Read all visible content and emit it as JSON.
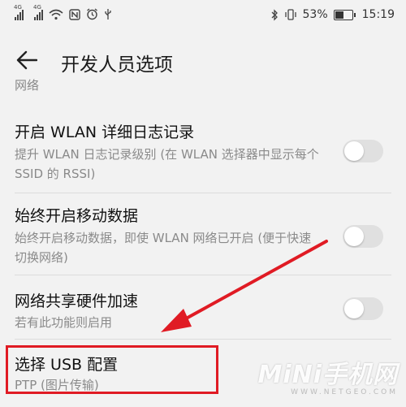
{
  "status_bar": {
    "signal1_tag": "4G",
    "signal2_tag": "4G",
    "battery_percent": "53%",
    "battery_level": 0.53,
    "time": "15:19",
    "icons": [
      "signal-icon",
      "signal-icon",
      "wifi-icon",
      "nfc-icon",
      "alarm-icon",
      "usb-icon",
      "bluetooth-icon",
      "vibrate-icon",
      "battery-icon"
    ]
  },
  "header": {
    "title": "开发人员选项",
    "back_icon": "back-arrow-icon"
  },
  "list": {
    "cut_section_label": "网络",
    "items": [
      {
        "title": "开启 WLAN 详细日志记录",
        "description": "提升 WLAN 日志记录级别 (在 WLAN 选择器中显示每个 SSID 的 RSSI)",
        "toggle_on": false
      },
      {
        "title": "始终开启移动数据",
        "description": "始终开启移动数据，即使 WLAN 网络已开启 (便于快速切换网络)",
        "toggle_on": false
      },
      {
        "title": "网络共享硬件加速",
        "description": "若有此功能则启用",
        "toggle_on": false
      },
      {
        "title": "选择 USB 配置",
        "description": "PTP (图片传输)"
      }
    ]
  },
  "annotation": {
    "highlight_color": "#e01b24"
  },
  "watermark": {
    "main": "MiNi手机网",
    "sub": "WWW.NETGEO.COM"
  }
}
